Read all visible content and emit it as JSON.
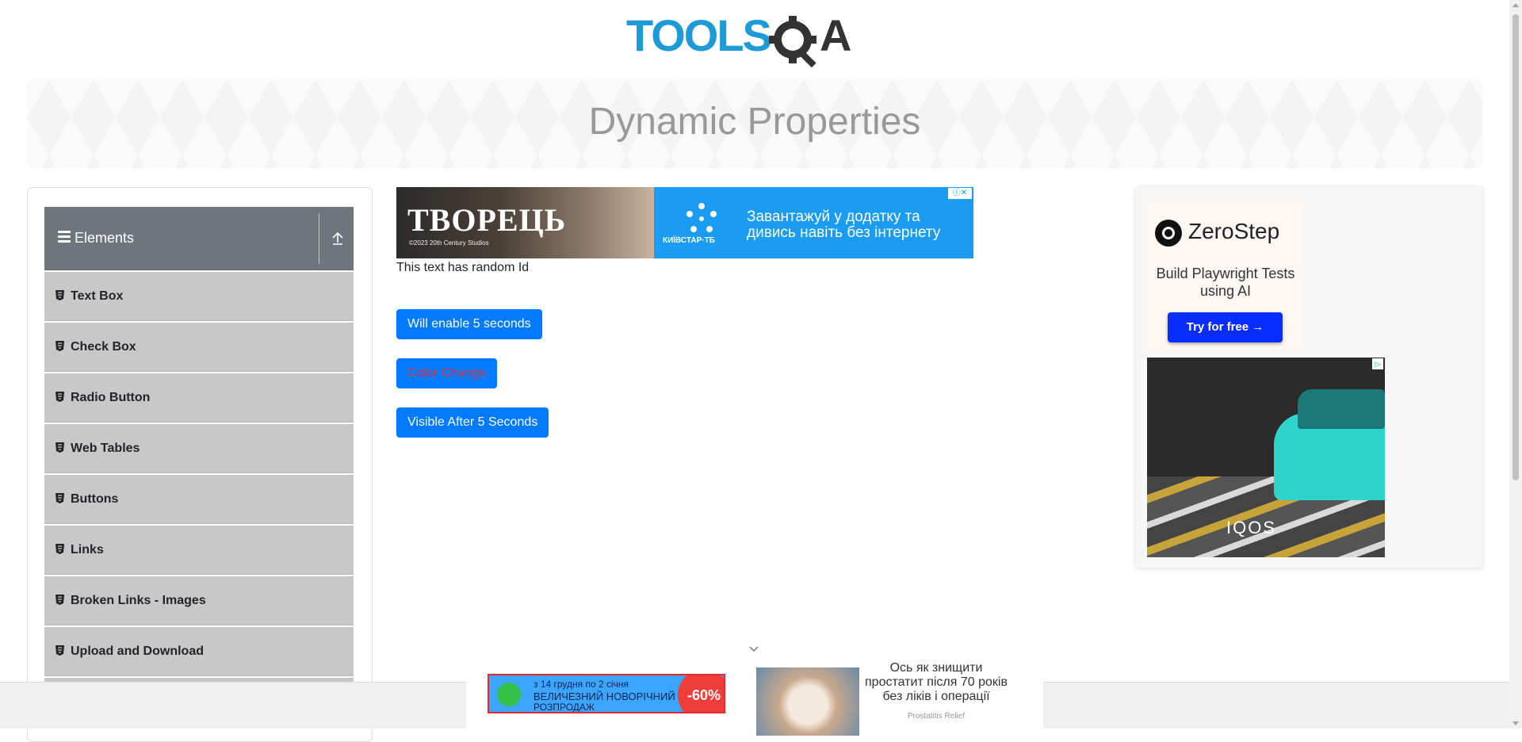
{
  "header": {
    "logo_text_tools": "TOOLS",
    "logo_text_qa": "QA"
  },
  "banner": {
    "title": "Dynamic Properties"
  },
  "sidebar": {
    "group_title": "Elements",
    "items": [
      {
        "label": "Text Box"
      },
      {
        "label": "Check Box"
      },
      {
        "label": "Radio Button"
      },
      {
        "label": "Web Tables"
      },
      {
        "label": "Buttons"
      },
      {
        "label": "Links"
      },
      {
        "label": "Broken Links - Images"
      },
      {
        "label": "Upload and Download"
      }
    ]
  },
  "main": {
    "random_id_text": "This text has random Id",
    "enable_button_label": "Will enable 5 seconds",
    "color_change_label": "Color Change",
    "visible_after_label": "Visible After 5 Seconds"
  },
  "ads": {
    "top": {
      "title": "ТВОРЕЦЬ",
      "studio": "©2023 20th Century Studios",
      "brand": "КИЇВСТАР·ТБ",
      "message": "Завантажуй у додатку та дивись навіть без інтернету"
    },
    "zerostep": {
      "brand": "ZeroStep",
      "tagline": "Build Playwright Tests using AI",
      "cta": "Try for free →"
    },
    "iqos": {
      "brand": "IQOS"
    },
    "bottom": {
      "sale_line1": "з 14 грудня по 2 січня",
      "sale_line2": "ВЕЛИЧЕЗНИЙ НОВОРІЧНИЙ",
      "sale_line3": "РОЗПРОДАЖ",
      "discount": "-60%",
      "headline": "Ось як знищити простатит після 70 років без ліків і операції",
      "source": "Prostatitis Relief"
    }
  },
  "colors": {
    "primary": "#007bff",
    "color_change_text": "#dc3545",
    "sidebar_header": "#6e757c",
    "sidebar_item": "#c8c8c8",
    "logo_blue": "#1e9ad6",
    "logo_dark": "#333333"
  }
}
